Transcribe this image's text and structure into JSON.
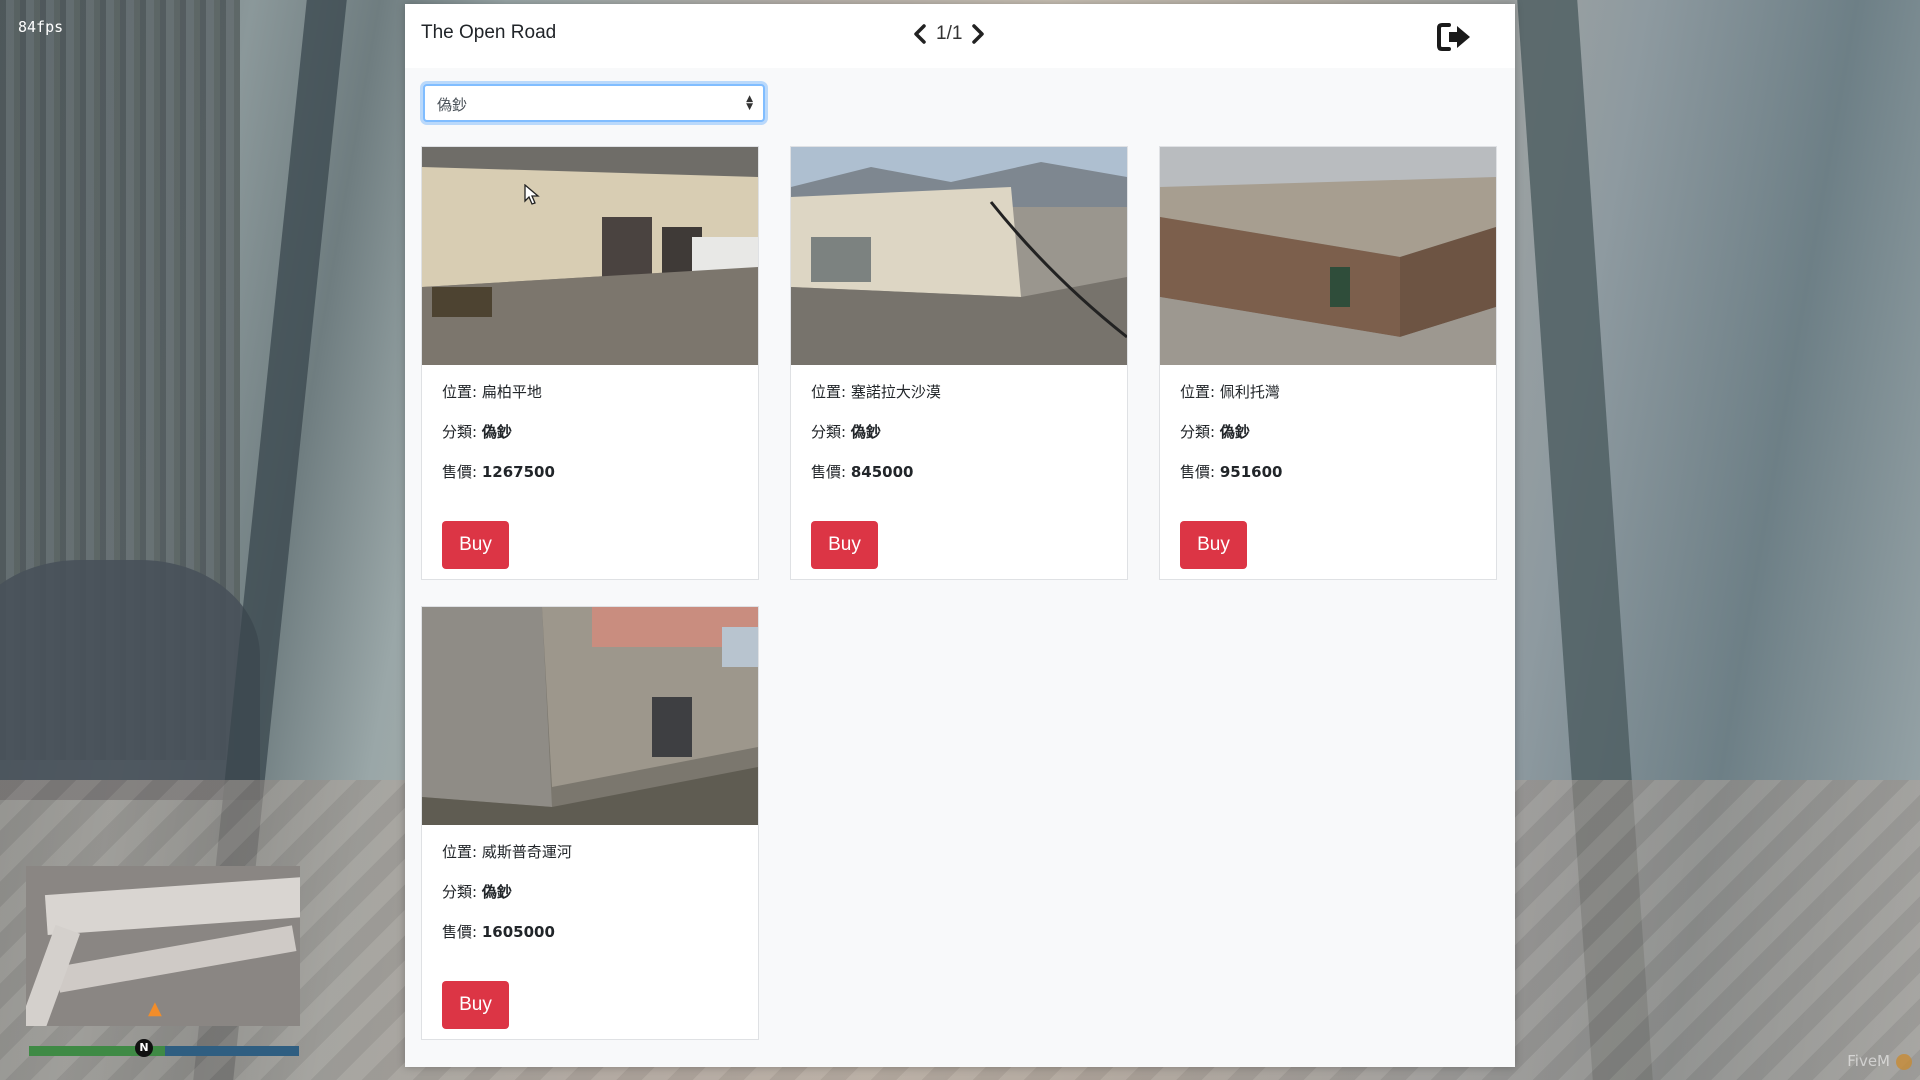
{
  "overlay": {
    "fps": "84fps",
    "watermark": "FiveM",
    "compass_letter": "N"
  },
  "header": {
    "title": "The Open Road",
    "page_indicator": "1/1"
  },
  "filter": {
    "selected": "偽鈔"
  },
  "labels": {
    "location": "位置: ",
    "category": "分類: ",
    "price": "售價: ",
    "buy": "Buy"
  },
  "listings": [
    {
      "location": "扁柏平地",
      "category": "偽鈔",
      "price": "1267500"
    },
    {
      "location": "塞諾拉大沙漠",
      "category": "偽鈔",
      "price": "845000"
    },
    {
      "location": "佩利托灣",
      "category": "偽鈔",
      "price": "951600"
    },
    {
      "location": "威斯普奇運河",
      "category": "偽鈔",
      "price": "1605000"
    }
  ],
  "colors": {
    "buy_button": "#dc3545",
    "panel_bg": "#f8f9fa",
    "focus_ring": "#80bdff"
  },
  "icons": {
    "prev": "chevron-left-icon",
    "next": "chevron-right-icon",
    "exit": "sign-out-icon",
    "select": "sort-caret-icon"
  }
}
